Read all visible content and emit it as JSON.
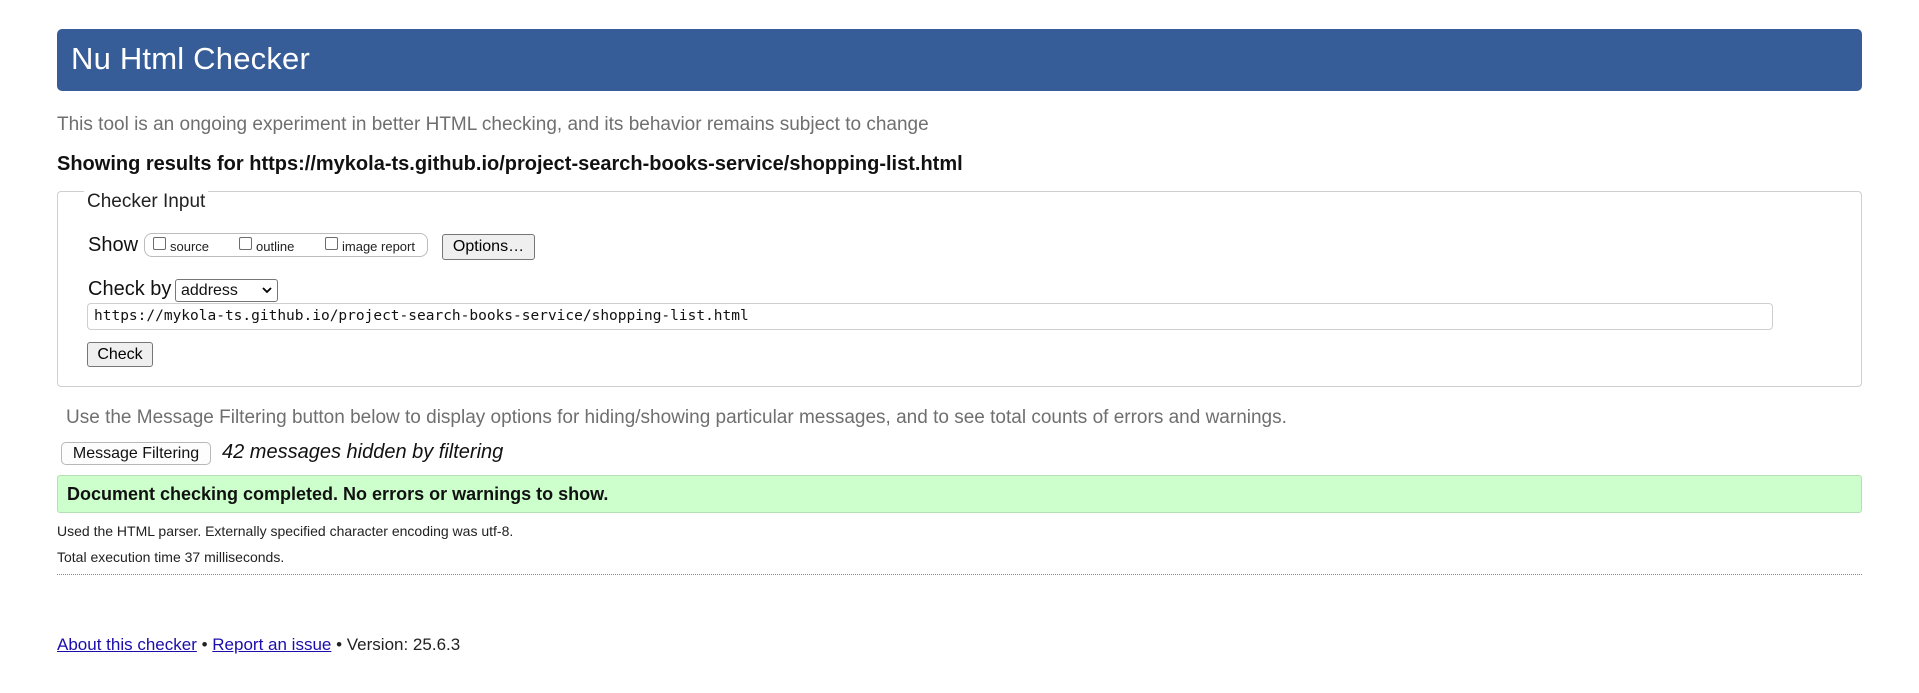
{
  "header": {
    "title": "Nu Html Checker"
  },
  "intro_text": "This tool is an ongoing experiment in better HTML checking, and its behavior remains subject to change",
  "results_heading": "Showing results for https://mykola-ts.github.io/project-search-books-service/shopping-list.html",
  "checker_input": {
    "legend": "Checker Input",
    "show_label": "Show",
    "show_options": [
      {
        "label": "source",
        "checked": false
      },
      {
        "label": "outline",
        "checked": false
      },
      {
        "label": "image report",
        "checked": false
      }
    ],
    "options_button": "Options…",
    "check_by_label": "Check by",
    "check_by_selected": "address",
    "url_value": "https://mykola-ts.github.io/project-search-books-service/shopping-list.html",
    "check_button": "Check"
  },
  "filter_info": "Use the Message Filtering button below to display options for hiding/showing particular messages, and to see total counts of errors and warnings.",
  "message_filtering_button": "Message Filtering",
  "hidden_messages": "42 messages hidden by filtering",
  "success_message": "Document checking completed. No errors or warnings to show.",
  "parser_info": "Used the HTML parser. Externally specified character encoding was utf-8.",
  "execution_time": "Total execution time 37 milliseconds.",
  "footer": {
    "about_link": "About this checker",
    "separator": "•",
    "report_link": "Report an issue",
    "version": "Version: 25.6.3"
  },
  "colors": {
    "header_bg": "#365d98",
    "success_bg": "#ccffcc",
    "link": "#1a0dab"
  }
}
